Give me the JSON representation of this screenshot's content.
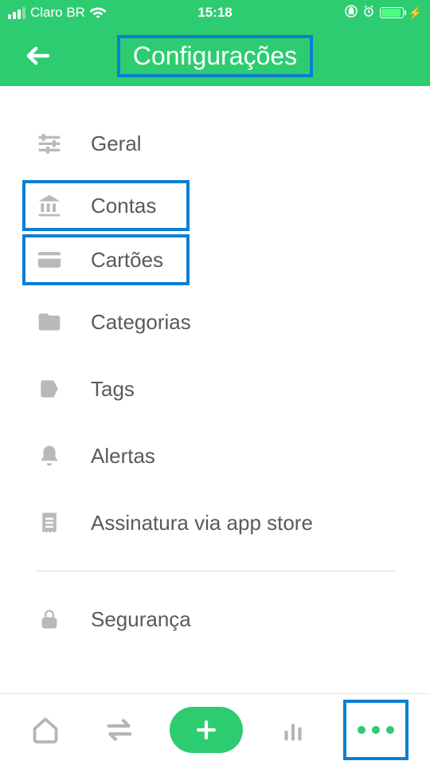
{
  "statusBar": {
    "carrier": "Claro BR",
    "time": "15:18"
  },
  "header": {
    "title": "Configurações"
  },
  "menu": {
    "items": [
      {
        "label": "Geral"
      },
      {
        "label": "Contas"
      },
      {
        "label": "Cartões"
      },
      {
        "label": "Categorias"
      },
      {
        "label": "Tags"
      },
      {
        "label": "Alertas"
      },
      {
        "label": "Assinatura via app store"
      },
      {
        "label": "Segurança"
      }
    ]
  },
  "colors": {
    "primary": "#2ECC71",
    "highlight": "#0A7FD4",
    "iconGray": "#B9B9B9"
  }
}
